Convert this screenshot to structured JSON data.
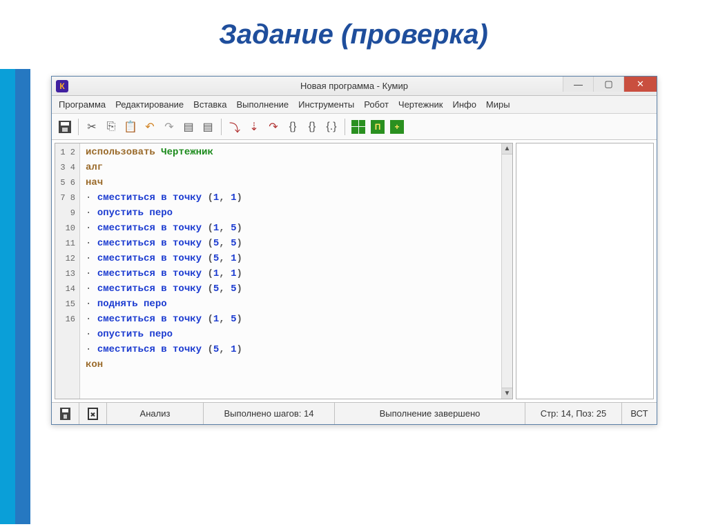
{
  "slide": {
    "title": "Задание (проверка)"
  },
  "titlebar": {
    "icon_letter": "К",
    "text": "Новая программа - Кумир"
  },
  "menu": [
    "Программа",
    "Редактирование",
    "Вставка",
    "Выполнение",
    "Инструменты",
    "Робот",
    "Чертежник",
    "Инфо",
    "Миры"
  ],
  "code": {
    "line_count": 16,
    "lines": [
      {
        "n": 1,
        "type": "use",
        "kw": "использовать",
        "mod": "Чертежник"
      },
      {
        "n": 2,
        "type": "alg",
        "text": "алг"
      },
      {
        "n": 3,
        "type": "alg",
        "text": "нач"
      },
      {
        "n": 4,
        "type": "cmd",
        "cmd": "сместиться в точку",
        "args": "(1, 1)"
      },
      {
        "n": 5,
        "type": "cmd",
        "cmd": "опустить перо",
        "args": ""
      },
      {
        "n": 6,
        "type": "cmd",
        "cmd": "сместиться в точку",
        "args": "(1, 5)"
      },
      {
        "n": 7,
        "type": "cmd",
        "cmd": "сместиться в точку",
        "args": "(5, 5)"
      },
      {
        "n": 8,
        "type": "cmd",
        "cmd": "сместиться в точку",
        "args": "(5, 1)"
      },
      {
        "n": 9,
        "type": "cmd",
        "cmd": "сместиться в точку",
        "args": "(1, 1)"
      },
      {
        "n": 10,
        "type": "cmd",
        "cmd": "сместиться в точку",
        "args": "(5, 5)"
      },
      {
        "n": 11,
        "type": "cmd",
        "cmd": "поднять перо",
        "args": ""
      },
      {
        "n": 12,
        "type": "cmd",
        "cmd": "сместиться в точку",
        "args": "(1, 5)"
      },
      {
        "n": 13,
        "type": "cmd",
        "cmd": "опустить перо",
        "args": ""
      },
      {
        "n": 14,
        "type": "cmd",
        "cmd": "сместиться в точку",
        "args": "(5, 1)"
      },
      {
        "n": 15,
        "type": "alg",
        "text": "кон"
      },
      {
        "n": 16,
        "type": "blank"
      }
    ]
  },
  "status": {
    "analysis": "Анализ",
    "steps": "Выполнено шагов: 14",
    "state": "Выполнение завершено",
    "pos": "Стр: 14, Поз: 25",
    "mode": "ВСТ"
  }
}
